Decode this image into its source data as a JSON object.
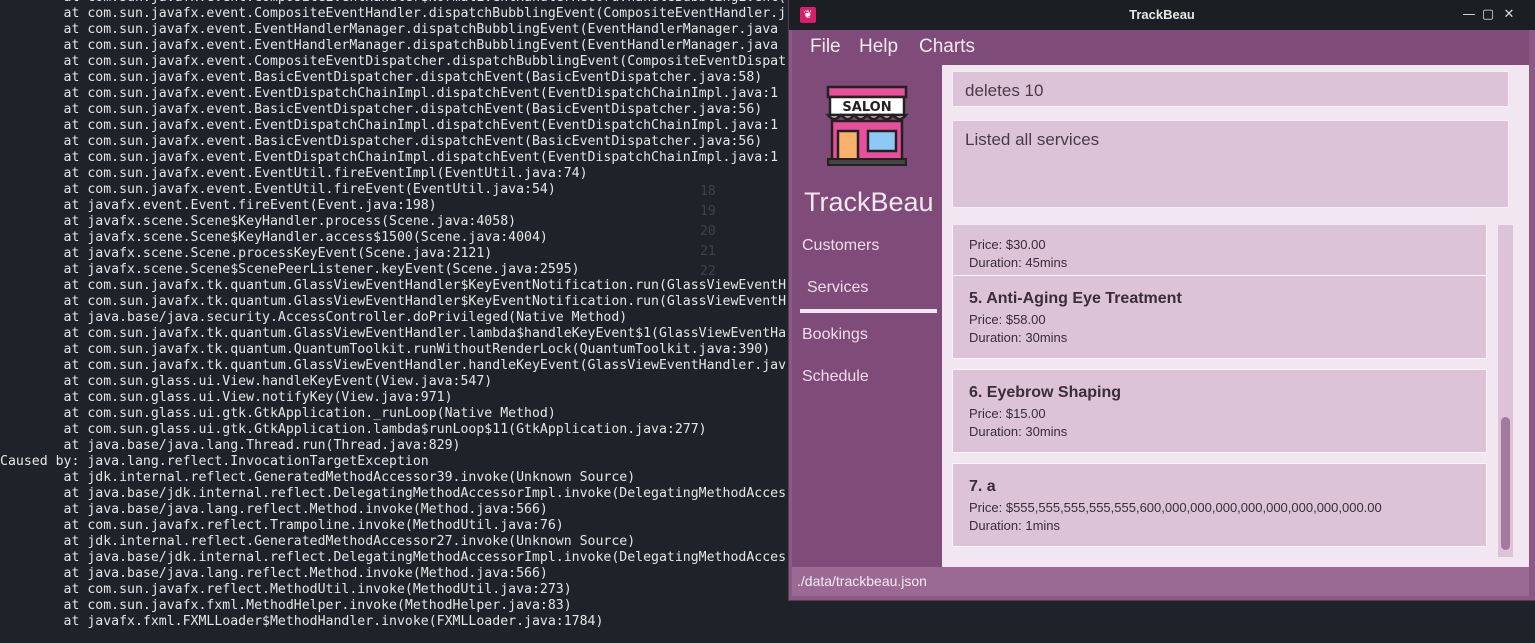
{
  "terminal": {
    "lines": [
      "        at com.sun.javafx.event.CompositeEventHandler$NormalEventHandlerRecord.handleBubblingEvent(",
      "        at com.sun.javafx.event.CompositeEventHandler.dispatchBubblingEvent(CompositeEventHandler.j",
      "        at com.sun.javafx.event.EventHandlerManager.dispatchBubblingEvent(EventHandlerManager.java",
      "        at com.sun.javafx.event.EventHandlerManager.dispatchBubblingEvent(EventHandlerManager.java",
      "        at com.sun.javafx.event.CompositeEventDispatcher.dispatchBubblingEvent(CompositeEventDispat",
      "        at com.sun.javafx.event.BasicEventDispatcher.dispatchEvent(BasicEventDispatcher.java:58)",
      "        at com.sun.javafx.event.EventDispatchChainImpl.dispatchEvent(EventDispatchChainImpl.java:1",
      "        at com.sun.javafx.event.BasicEventDispatcher.dispatchEvent(BasicEventDispatcher.java:56)",
      "        at com.sun.javafx.event.EventDispatchChainImpl.dispatchEvent(EventDispatchChainImpl.java:1",
      "        at com.sun.javafx.event.BasicEventDispatcher.dispatchEvent(BasicEventDispatcher.java:56)",
      "        at com.sun.javafx.event.EventDispatchChainImpl.dispatchEvent(EventDispatchChainImpl.java:1",
      "        at com.sun.javafx.event.EventUtil.fireEventImpl(EventUtil.java:74)",
      "        at com.sun.javafx.event.EventUtil.fireEvent(EventUtil.java:54)",
      "        at javafx.event.Event.fireEvent(Event.java:198)",
      "        at javafx.scene.Scene$KeyHandler.process(Scene.java:4058)",
      "        at javafx.scene.Scene$KeyHandler.access$1500(Scene.java:4004)",
      "        at javafx.scene.Scene.processKeyEvent(Scene.java:2121)",
      "        at javafx.scene.Scene$ScenePeerListener.keyEvent(Scene.java:2595)",
      "        at com.sun.javafx.tk.quantum.GlassViewEventHandler$KeyEventNotification.run(GlassViewEventH",
      "        at com.sun.javafx.tk.quantum.GlassViewEventHandler$KeyEventNotification.run(GlassViewEventH",
      "        at java.base/java.security.AccessController.doPrivileged(Native Method)",
      "        at com.sun.javafx.tk.quantum.GlassViewEventHandler.lambda$handleKeyEvent$1(GlassViewEventHa",
      "        at com.sun.javafx.tk.quantum.QuantumToolkit.runWithoutRenderLock(QuantumToolkit.java:390)",
      "        at com.sun.javafx.tk.quantum.GlassViewEventHandler.handleKeyEvent(GlassViewEventHandler.jav",
      "        at com.sun.glass.ui.View.handleKeyEvent(View.java:547)",
      "        at com.sun.glass.ui.View.notifyKey(View.java:971)",
      "        at com.sun.glass.ui.gtk.GtkApplication._runLoop(Native Method)",
      "        at com.sun.glass.ui.gtk.GtkApplication.lambda$runLoop$11(GtkApplication.java:277)",
      "        at java.base/java.lang.Thread.run(Thread.java:829)",
      "Caused by: java.lang.reflect.InvocationTargetException",
      "        at jdk.internal.reflect.GeneratedMethodAccessor39.invoke(Unknown Source)",
      "        at java.base/jdk.internal.reflect.DelegatingMethodAccessorImpl.invoke(DelegatingMethodAcces",
      "        at java.base/java.lang.reflect.Method.invoke(Method.java:566)",
      "        at com.sun.javafx.reflect.Trampoline.invoke(MethodUtil.java:76)",
      "        at jdk.internal.reflect.GeneratedMethodAccessor27.invoke(Unknown Source)",
      "        at java.base/jdk.internal.reflect.DelegatingMethodAccessorImpl.invoke(DelegatingMethodAcces",
      "        at java.base/java.lang.reflect.Method.invoke(Method.java:566)",
      "        at com.sun.javafx.reflect.MethodUtil.invoke(MethodUtil.java:273)",
      "        at com.sun.javafx.fxml.MethodHelper.invoke(MethodHelper.java:83)",
      "        at javafx.fxml.FXMLLoader$MethodHandler.invoke(FXMLLoader.java:1784)"
    ]
  },
  "window": {
    "title": "TrackBeau"
  },
  "menu": {
    "file": "File",
    "help": "Help",
    "charts": "Charts"
  },
  "sidebar": {
    "logo_text": "SALON",
    "brand": "TrackBeau",
    "items": [
      {
        "label": "Customers"
      },
      {
        "label": "Services"
      },
      {
        "label": "Bookings"
      },
      {
        "label": "Schedule"
      }
    ],
    "selected": "Services"
  },
  "command": {
    "value": "deletes 10"
  },
  "result": {
    "text": "Listed all services"
  },
  "services": [
    {
      "title": "",
      "price": "Price: $30.00",
      "duration": "Duration:  45mins"
    },
    {
      "title": "5.  Anti-Aging Eye Treatment",
      "price": "Price: $58.00",
      "duration": "Duration:  30mins"
    },
    {
      "title": "6.  Eyebrow Shaping",
      "price": "Price: $15.00",
      "duration": "Duration:  30mins"
    },
    {
      "title": "7.  a",
      "price": "Price: $555,555,555,555,555,600,000,000,000,000,000,000,000,000.00",
      "duration": "Duration:  1mins"
    }
  ],
  "status": {
    "path": "./data/trackbeau.json"
  },
  "colors": {
    "accent": "#7f4b78",
    "panel": "#dcc3d8",
    "status_bar": "#9a6a93"
  }
}
